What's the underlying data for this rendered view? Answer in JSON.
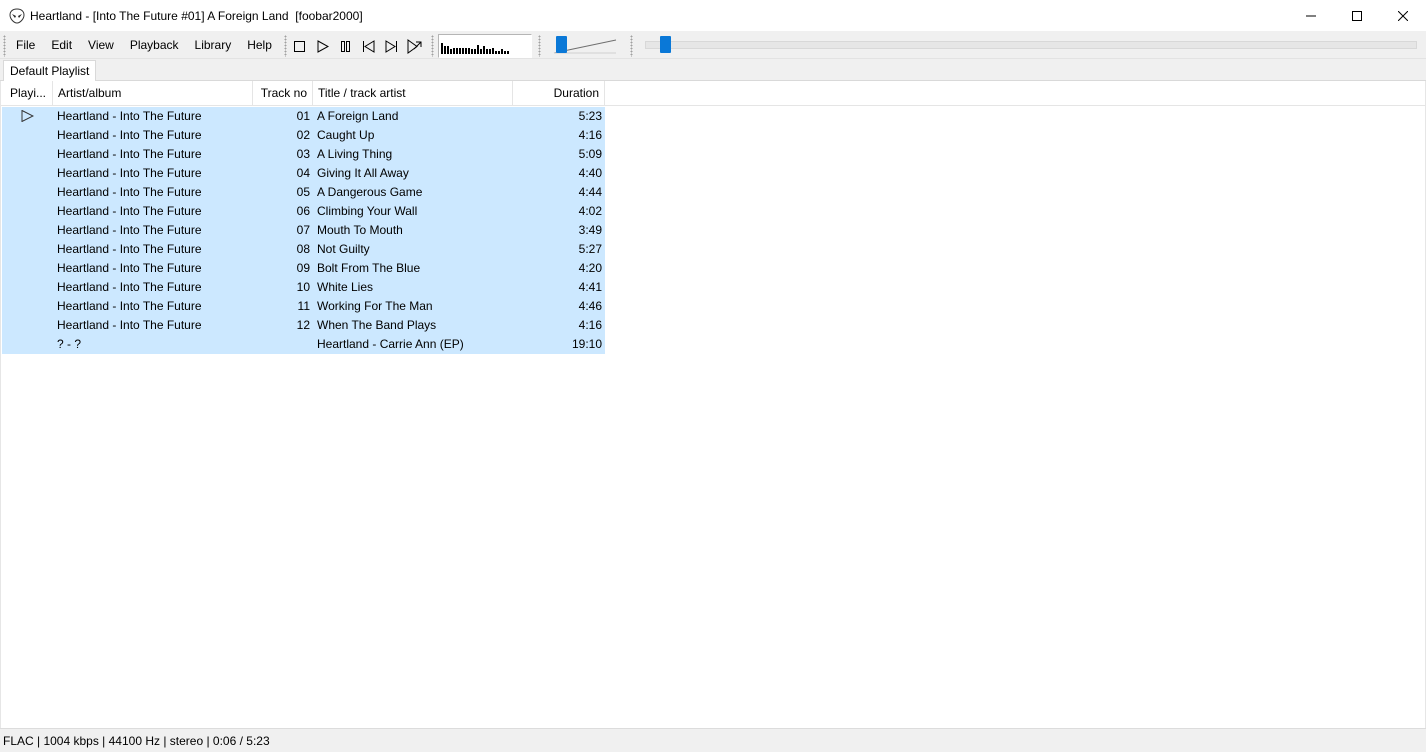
{
  "window": {
    "title": "Heartland - [Into The Future #01] A Foreign Land  [foobar2000]",
    "app_icon": "alien-head-icon"
  },
  "menu": [
    "File",
    "Edit",
    "View",
    "Playback",
    "Library",
    "Help"
  ],
  "toolbar": {
    "buttons": [
      "stop-icon",
      "play-icon",
      "pause-icon",
      "previous-icon",
      "next-icon",
      "random-icon"
    ]
  },
  "visualisation": {
    "levels": [
      0.8,
      0.55,
      0.55,
      0.35,
      0.45,
      0.45,
      0.4,
      0.4,
      0.45,
      0.4,
      0.35,
      0.35,
      0.65,
      0.35,
      0.55,
      0.35,
      0.35,
      0.45,
      0.2,
      0.2,
      0.35,
      0.2,
      0.2
    ]
  },
  "volume": {
    "level": 0.1
  },
  "seekbar": {
    "position_seconds": 6,
    "length_seconds": 323
  },
  "tabs": [
    {
      "label": "Default Playlist"
    }
  ],
  "playlist": {
    "columns": {
      "playing": "Playi...",
      "artist_album": "Artist/album",
      "track_no": "Track no",
      "title": "Title / track artist",
      "duration": "Duration"
    },
    "rows": [
      {
        "artist_album": "Heartland - Into The Future",
        "track": "01",
        "title": "A Foreign Land",
        "duration": "5:23",
        "playing": true
      },
      {
        "artist_album": "Heartland - Into The Future",
        "track": "02",
        "title": "Caught Up",
        "duration": "4:16"
      },
      {
        "artist_album": "Heartland - Into The Future",
        "track": "03",
        "title": "A Living Thing",
        "duration": "5:09"
      },
      {
        "artist_album": "Heartland - Into The Future",
        "track": "04",
        "title": "Giving It All Away",
        "duration": "4:40"
      },
      {
        "artist_album": "Heartland - Into The Future",
        "track": "05",
        "title": "A Dangerous Game",
        "duration": "4:44"
      },
      {
        "artist_album": "Heartland - Into The Future",
        "track": "06",
        "title": "Climbing Your Wall",
        "duration": "4:02"
      },
      {
        "artist_album": "Heartland - Into The Future",
        "track": "07",
        "title": "Mouth To Mouth",
        "duration": "3:49"
      },
      {
        "artist_album": "Heartland - Into The Future",
        "track": "08",
        "title": "Not Guilty",
        "duration": "5:27"
      },
      {
        "artist_album": "Heartland - Into The Future",
        "track": "09",
        "title": "Bolt From The Blue",
        "duration": "4:20"
      },
      {
        "artist_album": "Heartland - Into The Future",
        "track": "10",
        "title": "White Lies",
        "duration": "4:41"
      },
      {
        "artist_album": "Heartland - Into The Future",
        "track": "11",
        "title": "Working For The Man",
        "duration": "4:46"
      },
      {
        "artist_album": "Heartland - Into The Future",
        "track": "12",
        "title": "When The Band Plays",
        "duration": "4:16"
      },
      {
        "artist_album": "? - ?",
        "track": "",
        "title": "Heartland - Carrie Ann (EP)",
        "duration": "19:10"
      }
    ],
    "selection_color": "#cce8ff"
  },
  "status": {
    "text": "FLAC | 1004 kbps | 44100 Hz | stereo | 0:06 / 5:23"
  },
  "colors": {
    "accent": "#0a78d7",
    "toolbar_bg": "#f0f0f0"
  }
}
